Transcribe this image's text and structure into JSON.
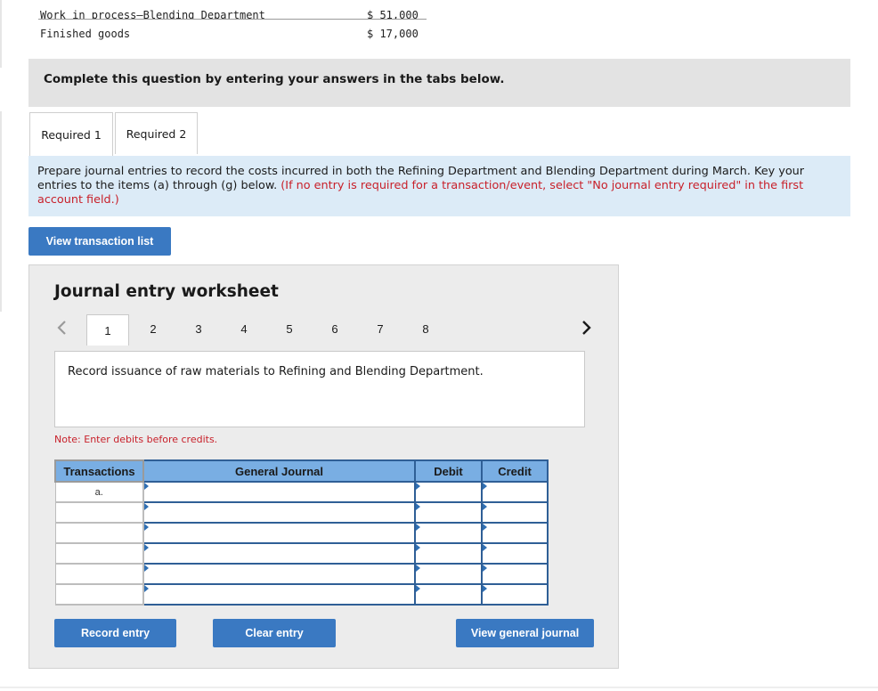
{
  "top_lines": [
    {
      "label": "Work in process—Blending Department",
      "value": "$ 51,000"
    },
    {
      "label": "Finished goods",
      "value": "$ 17,000"
    }
  ],
  "banner": "Complete this question by entering your answers in the tabs below.",
  "tabs": [
    "Required 1",
    "Required 2"
  ],
  "instruction": {
    "text": "Prepare journal entries to record the costs incurred in both the Refining Department and Blending Department during March. Key your entries to the items (a) through (g) below.",
    "note": "(If no entry is required for a transaction/event, select \"No journal entry required\" in the first account field.)"
  },
  "view_transaction_list": "View transaction list",
  "worksheet": {
    "title": "Journal entry worksheet",
    "prev_icon": "chevron-left-icon",
    "next_icon": "chevron-right-icon",
    "pages": [
      "1",
      "2",
      "3",
      "4",
      "5",
      "6",
      "7",
      "8"
    ],
    "active_page": "1",
    "description": "Record issuance of raw materials to Refining and Blending Department.",
    "note": "Note: Enter debits before credits.",
    "table": {
      "headers": [
        "Transactions",
        "General Journal",
        "Debit",
        "Credit"
      ],
      "rows": [
        "a.",
        "",
        "",
        "",
        "",
        ""
      ]
    },
    "buttons": {
      "record": "Record entry",
      "clear": "Clear entry",
      "view_journal": "View general journal"
    }
  },
  "colors": {
    "button_blue": "#3a79c2",
    "header_blue": "#79aee3",
    "info_bg": "#dcebf7",
    "note_red": "#c8202a"
  }
}
